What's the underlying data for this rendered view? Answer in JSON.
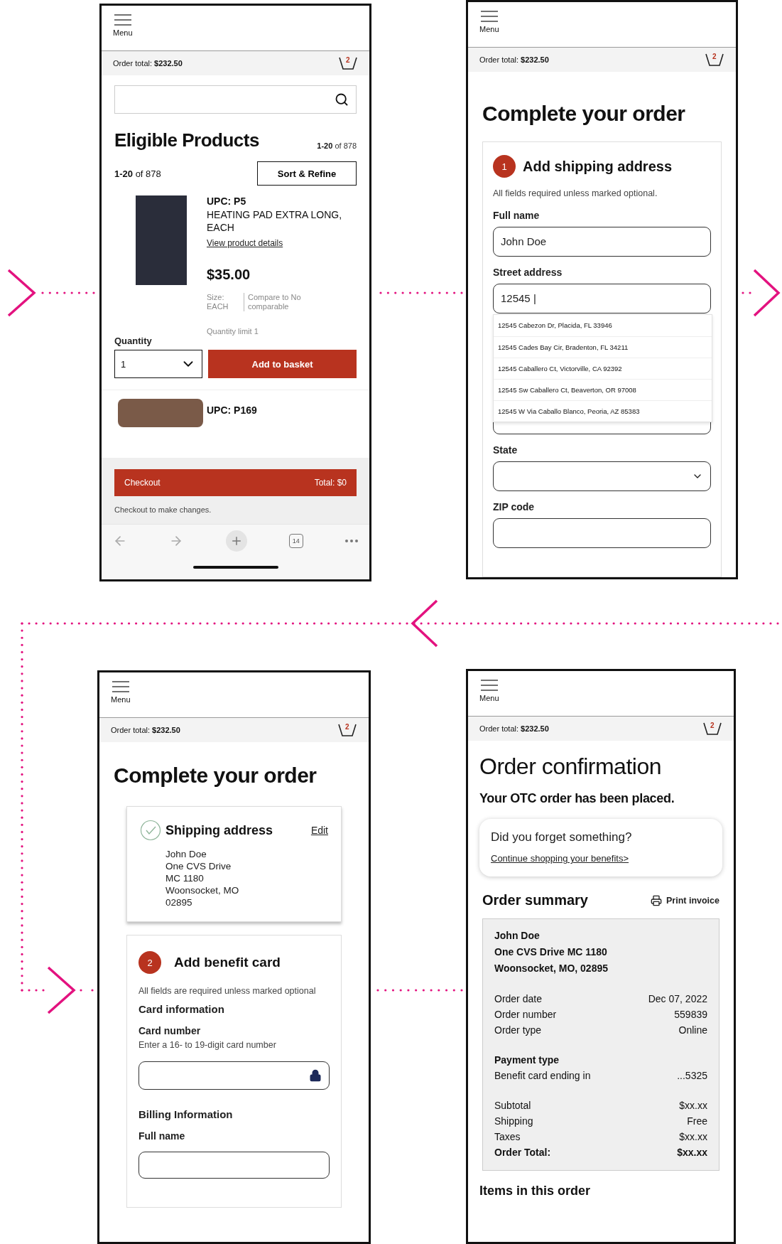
{
  "screens": [
    {
      "kind": "product_list",
      "header": {
        "menu_label": "Menu",
        "order_total_label": "Order total:",
        "order_total_value": "$232.50",
        "cart_count": "2"
      },
      "title": "Eligible Products",
      "title_count": "**1-20** of 878",
      "count": "**1-20** of 878",
      "sort_button": "Sort & Refine",
      "product": {
        "upc": "UPC: P5",
        "name": "HEATING PAD EXTRA LONG, EACH",
        "details_link": "View product details",
        "price": "$35.00",
        "size": "Size: EACH",
        "compare": "Compare to No comparable",
        "limit": "Quantity limit 1",
        "quantity_label": "Quantity",
        "quantity": "1",
        "add_button": "Add to basket"
      },
      "next_product": {
        "upc": "UPC: P169"
      },
      "checkout": {
        "button": "Checkout",
        "total": "Total: $0",
        "note": "Checkout to make changes."
      },
      "browser_bar": {
        "tab_count": "14"
      }
    },
    {
      "kind": "shipping_form",
      "header": {
        "menu_label": "Menu",
        "order_total_label": "Order total:",
        "order_total_value": "$232.50",
        "cart_count": "2"
      },
      "title": "Complete your order",
      "step": {
        "number": "1",
        "title": "Add shipping address",
        "note": "All fields required unless marked optional."
      },
      "fields": [
        {
          "kind": "text",
          "label": "Full name",
          "value": "John Doe"
        },
        {
          "kind": "text",
          "label": "Street address",
          "value": "12545 |",
          "suggestions": [
            "12545 Cabezon Dr, Placida, FL 33946",
            "12545 Cades Bay Cir, Bradenton, FL 34211",
            "12545 Caballero Ct, Victorville, CA 92392",
            "12545 Sw Caballero Ct, Beaverton, OR 97008",
            "12545 W Via Caballo Blanco, Peoria, AZ 85383"
          ]
        },
        {
          "kind": "text"
        },
        {
          "kind": "select",
          "label": "State"
        },
        {
          "kind": "text",
          "label": "ZIP code"
        }
      ]
    },
    {
      "kind": "benefit_form",
      "header": {
        "menu_label": "Menu",
        "order_total_label": "Order total:",
        "order_total_value": "$232.50",
        "cart_count": "2"
      },
      "title": "Complete your order",
      "shipping": {
        "title": "Shipping address",
        "edit_link": "Edit",
        "lines": [
          "John Doe",
          "One CVS Drive",
          "MC 1180",
          "Woonsocket, MO",
          "02895"
        ]
      },
      "step": {
        "number": "2",
        "title": "Add benefit card",
        "note": "All fields are required unless marked optional"
      },
      "sections": [
        {
          "heading": "Card information",
          "fields": [
            {
              "kind": "secure",
              "label": "Card number",
              "hint": "Enter a 16- to 19-digit card number"
            }
          ]
        },
        {
          "heading": "Billing Information",
          "fields": [
            {
              "kind": "text",
              "label": "Full name"
            }
          ]
        }
      ]
    },
    {
      "kind": "confirmation",
      "header": {
        "menu_label": "Menu",
        "order_total_label": "Order total:",
        "order_total_value": "$232.50",
        "cart_count": "2"
      },
      "title": "Order confirmation",
      "message": "Your OTC order has been placed.",
      "reminder": {
        "question": "Did you forget something?",
        "link": "Continue shopping your benefits>"
      },
      "summary_title": "Order summary",
      "print_button": "Print invoice",
      "address": [
        "John Doe",
        "One CVS Drive MC 1180",
        "Woonsocket, MO, 02895"
      ],
      "groups": [
        {
          "rows": [
            {
              "label": "Order date",
              "value": "Dec 07, 2022",
              "total": false
            },
            {
              "label": "Order number",
              "value": "559839",
              "total": false
            },
            {
              "label": "Order type",
              "value": "Online",
              "total": false
            }
          ]
        },
        {
          "heading": "Payment type",
          "rows": [
            {
              "label": "Benefit card ending in",
              "value": "...5325",
              "total": false
            }
          ]
        },
        {
          "rows": [
            {
              "label": "Subtotal",
              "value": "$xx.xx",
              "total": false
            },
            {
              "label": "Shipping",
              "value": "Free",
              "total": false
            },
            {
              "label": "Taxes",
              "value": "$xx.xx",
              "total": false
            },
            {
              "label": "Order Total:",
              "value": "$xx.xx",
              "total": true
            }
          ]
        }
      ],
      "items_title": "Items in this order"
    }
  ]
}
